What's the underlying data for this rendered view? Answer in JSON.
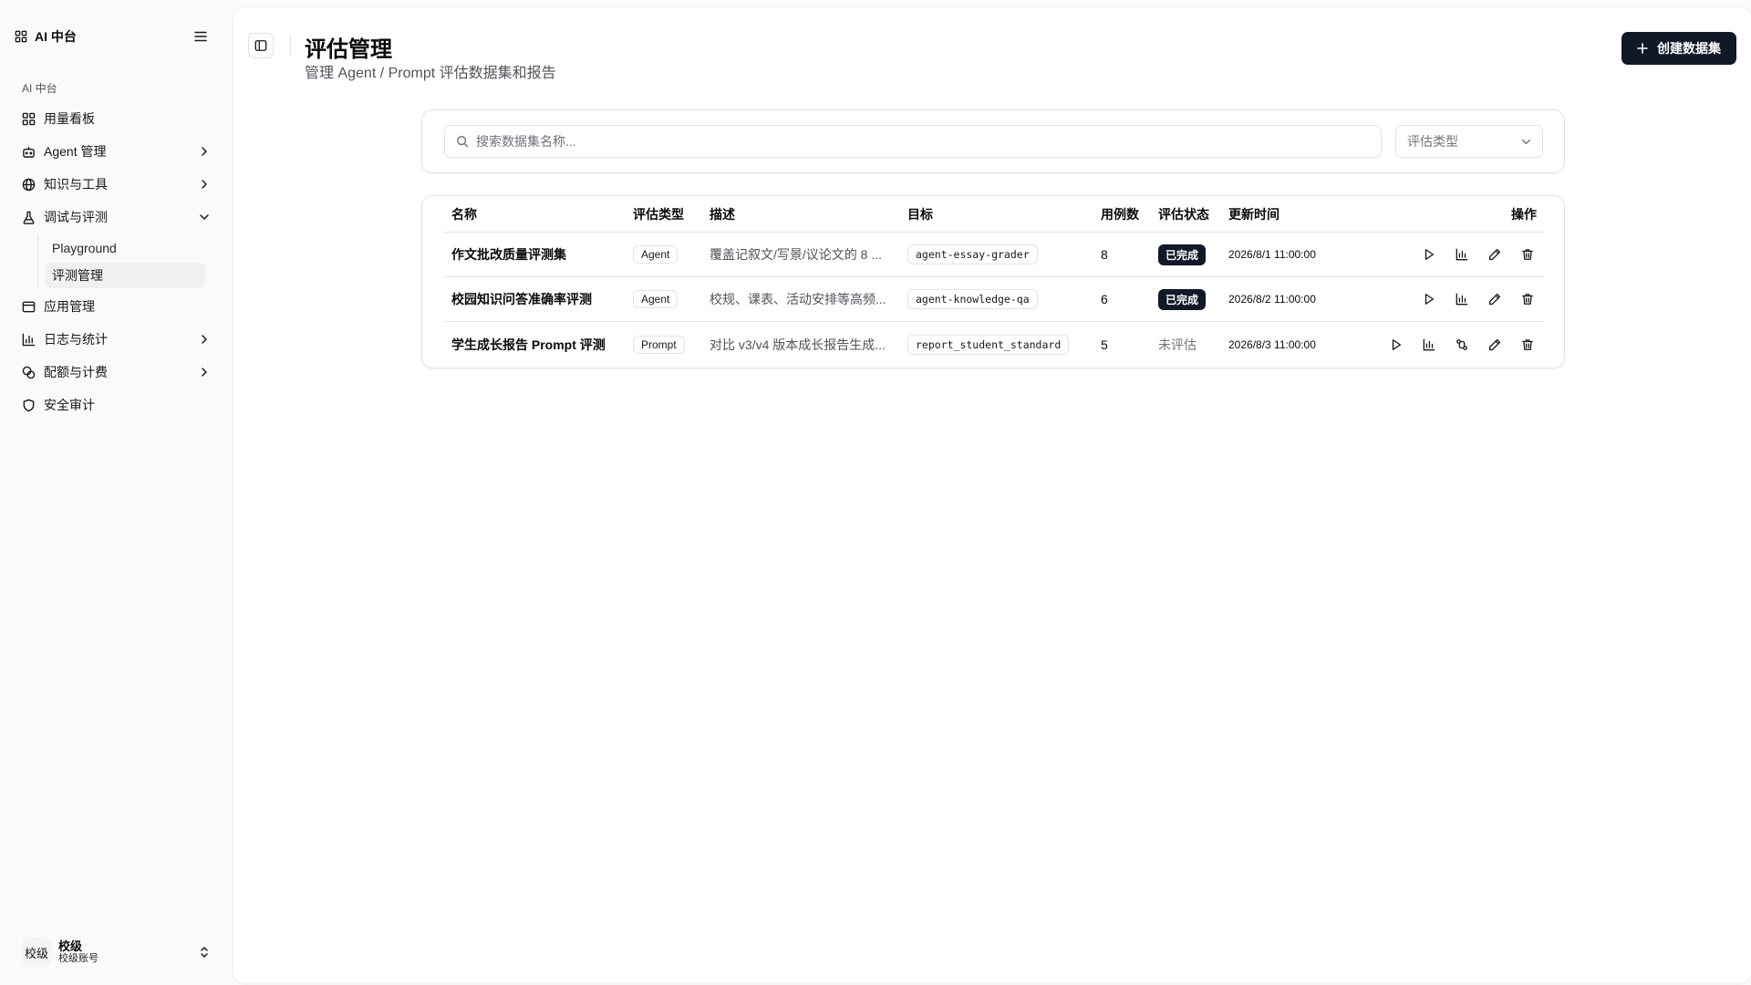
{
  "sidebar": {
    "brand": "AI 中台",
    "group_label": "AI 中台",
    "items": [
      {
        "label": "用量看板"
      },
      {
        "label": "Agent 管理"
      },
      {
        "label": "知识与工具"
      },
      {
        "label": "调试与评测"
      },
      {
        "label": "应用管理"
      },
      {
        "label": "日志与统计"
      },
      {
        "label": "配额与计费"
      },
      {
        "label": "安全审计"
      }
    ],
    "sub_items": [
      {
        "label": "Playground"
      },
      {
        "label": "评测管理"
      }
    ],
    "user": {
      "avatar": "校级",
      "name": "校级",
      "sub": "校级账号"
    }
  },
  "header": {
    "title": "评估管理",
    "subtitle": "管理 Agent / Prompt 评估数据集和报告",
    "create_label": "创建数据集"
  },
  "filters": {
    "search_placeholder": "搜索数据集名称...",
    "type_select_placeholder": "评估类型"
  },
  "table": {
    "columns": {
      "name": "名称",
      "type": "评估类型",
      "desc": "描述",
      "target": "目标",
      "count": "用例数",
      "status": "评估状态",
      "time": "更新时间",
      "ops": "操作"
    },
    "rows": [
      {
        "name": "作文批改质量评测集",
        "type": "Agent",
        "desc": "覆盖记叙文/写景/议论文的 8 ...",
        "target": "agent-essay-grader",
        "count": "8",
        "status": "已完成",
        "time": "2026/8/1 11:00:00"
      },
      {
        "name": "校园知识问答准确率评测",
        "type": "Agent",
        "desc": "校规、课表、活动安排等高频...",
        "target": "agent-knowledge-qa",
        "count": "6",
        "status": "已完成",
        "time": "2026/8/2 11:00:00"
      },
      {
        "name": "学生成长报告 Prompt 评测",
        "type": "Prompt",
        "desc": "对比 v3/v4 版本成长报告生成...",
        "target": "report_student_standard",
        "count": "5",
        "status": "未评估",
        "time": "2026/8/3 11:00:00"
      }
    ]
  },
  "colors": {
    "primary": "#111827",
    "muted": "#52525b",
    "border": "#e4e4e7"
  }
}
